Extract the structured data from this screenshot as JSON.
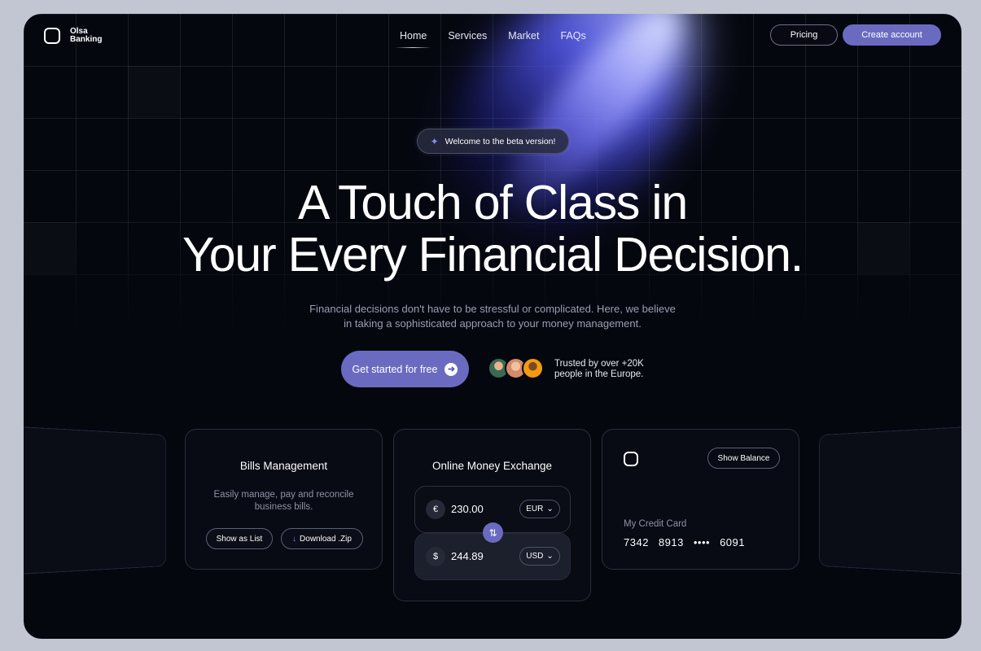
{
  "brand": {
    "name": "Olsa Banking",
    "line1": "Olsa",
    "line2": "Banking",
    "accent": "#6a6bc0"
  },
  "nav": {
    "items": [
      "Home",
      "Services",
      "Market",
      "FAQs"
    ],
    "active": "Home"
  },
  "header": {
    "pricing_label": "Pricing",
    "create_label": "Create account"
  },
  "hero": {
    "badge": "Welcome to the beta version!",
    "title_line1": "A Touch of Class in",
    "title_line2": "Your Every Financial Decision.",
    "subtitle_line1": "Financial decisions don't have to be stressful or complicated.  Here, we believe",
    "subtitle_line2": "in taking a sophisticated approach to your money management.",
    "cta_label": "Get started for free",
    "trusted_line1": "Trusted by over +20K",
    "trusted_line2": "people in the Europe."
  },
  "bills": {
    "title": "Bills Management",
    "desc_line1": "Easily manage, pay and reconcile",
    "desc_line2": "business bills.",
    "show_list_label": "Show as List",
    "download_label": "Download .Zip"
  },
  "exchange": {
    "title": "Online Money Exchange",
    "from": {
      "symbol": "€",
      "amount": "230.00",
      "currency": "EUR"
    },
    "to": {
      "symbol": "$",
      "amount": "244.89",
      "currency": "USD"
    }
  },
  "credit_card": {
    "show_balance_label": "Show Balance",
    "label": "My Credit Card",
    "groups": [
      "7342",
      "8913",
      "••••",
      "6091"
    ]
  },
  "icons": [
    "logo-mark-icon",
    "sparkle-icon",
    "arrow-right-icon",
    "download-icon",
    "chevron-down-icon",
    "swap-icon"
  ]
}
